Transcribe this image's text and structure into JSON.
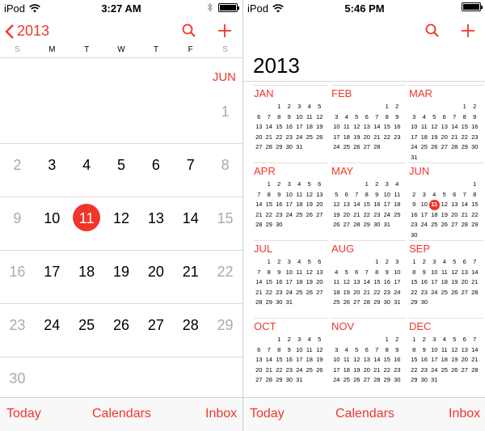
{
  "left": {
    "status": {
      "carrier": "iPod",
      "time": "3:27 AM"
    },
    "nav": {
      "back_label": "2013"
    },
    "weekdays": [
      "S",
      "M",
      "T",
      "W",
      "T",
      "F",
      "S"
    ],
    "month_marker": "JUN",
    "weeks": [
      [
        "",
        "",
        "",
        "",
        "",
        "",
        "1"
      ],
      [
        "2",
        "3",
        "4",
        "5",
        "6",
        "7",
        "8"
      ],
      [
        "9",
        "10",
        "11",
        "12",
        "13",
        "14",
        "15"
      ],
      [
        "16",
        "17",
        "18",
        "19",
        "20",
        "21",
        "22"
      ],
      [
        "23",
        "24",
        "25",
        "26",
        "27",
        "28",
        "29"
      ],
      [
        "30",
        "",
        "",
        "",
        "",
        "",
        ""
      ]
    ],
    "today": "11",
    "tabbar": {
      "today": "Today",
      "calendars": "Calendars",
      "inbox": "Inbox"
    }
  },
  "right": {
    "status": {
      "carrier": "iPod",
      "time": "5:46 PM"
    },
    "year": "2013",
    "highlight": {
      "month": "JUN",
      "day": "11"
    },
    "months": [
      {
        "name": "JAN",
        "offset": 2,
        "days": 31
      },
      {
        "name": "FEB",
        "offset": 5,
        "days": 28
      },
      {
        "name": "MAR",
        "offset": 5,
        "days": 31
      },
      {
        "name": "APR",
        "offset": 1,
        "days": 30
      },
      {
        "name": "MAY",
        "offset": 3,
        "days": 31
      },
      {
        "name": "JUN",
        "offset": 6,
        "days": 30
      },
      {
        "name": "JUL",
        "offset": 1,
        "days": 31
      },
      {
        "name": "AUG",
        "offset": 4,
        "days": 31
      },
      {
        "name": "SEP",
        "offset": 0,
        "days": 30
      },
      {
        "name": "OCT",
        "offset": 2,
        "days": 31
      },
      {
        "name": "NOV",
        "offset": 5,
        "days": 30
      },
      {
        "name": "DEC",
        "offset": 0,
        "days": 31
      }
    ],
    "tabbar": {
      "today": "Today",
      "calendars": "Calendars",
      "inbox": "Inbox"
    }
  },
  "colors": {
    "accent": "#f0362b",
    "weekend": "#aaaaaa",
    "divider": "#d9d9d9"
  },
  "icons": [
    "wifi-icon",
    "bluetooth-icon",
    "battery-icon",
    "chevron-left-icon",
    "search-icon",
    "plus-icon"
  ]
}
